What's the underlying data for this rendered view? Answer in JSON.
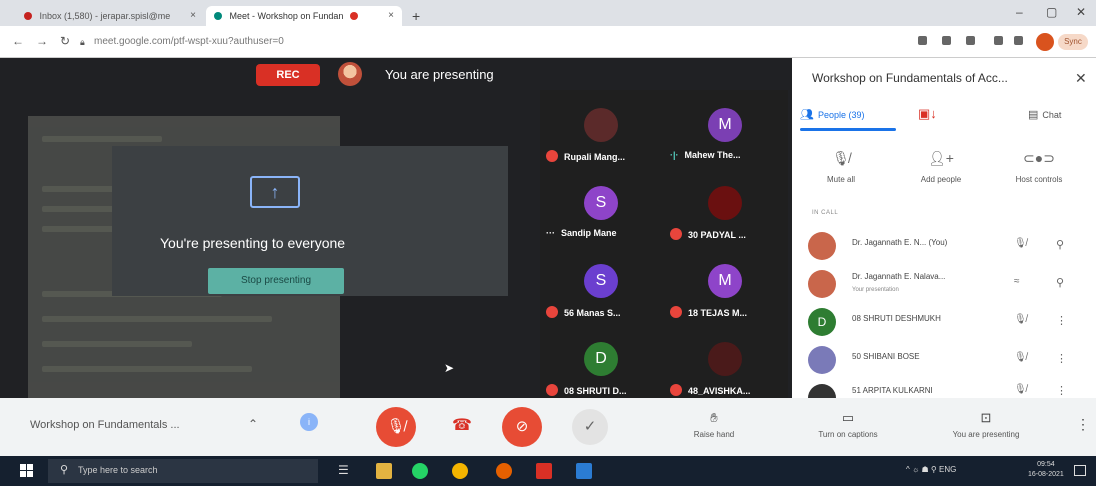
{
  "browser": {
    "tabs": [
      {
        "label": "Inbox (1,580) - jerapar.spisl@me"
      },
      {
        "label": "Meet - Workshop on Fundan"
      }
    ],
    "new_tab_symbol": "+",
    "url": "meet.google.com/ptf-wspt-xuu?authuser=0",
    "sync_label": "Sync"
  },
  "stage": {
    "rec_label": "REC",
    "presenting_label": "You are presenting",
    "presenting_to_everyone": "You're presenting to everyone",
    "stop_presenting_label": "Stop presenting"
  },
  "tiles": [
    {
      "initial": "",
      "name": "Rupali Mang...",
      "color": "#5b2a2a",
      "indicator": "mute"
    },
    {
      "initial": "M",
      "name": "Mahew The...",
      "color": "#7b3fb3",
      "indicator": "speaking"
    },
    {
      "initial": "S",
      "name": "Sandip Mane",
      "color": "#8e44c9",
      "indicator": "more"
    },
    {
      "initial": "",
      "name": "30 PADYAL ...",
      "color": "#6a1010",
      "indicator": "mute"
    },
    {
      "initial": "S",
      "name": "56 Manas S...",
      "color": "#6b3fcf",
      "indicator": "mute"
    },
    {
      "initial": "M",
      "name": "18 TEJAS M...",
      "color": "#8e44c9",
      "indicator": "mute"
    },
    {
      "initial": "D",
      "name": "08 SHRUTI D...",
      "color": "#2e7d32",
      "indicator": "mute"
    },
    {
      "initial": "",
      "name": "48_AVISHKA...",
      "color": "#4a1a1a",
      "indicator": "mute"
    }
  ],
  "panel": {
    "title": "Workshop on Fundamentals of Acc...",
    "tabs": {
      "people": "People (39)",
      "chat": "Chat"
    },
    "actions": {
      "mute_all": "Mute all",
      "add_people": "Add people",
      "host_controls": "Host controls"
    },
    "in_call_label": "IN CALL",
    "participants": [
      {
        "initial": "",
        "name": "Dr. Jagannath E. N... (You)",
        "sub": "",
        "color": "#c9664b",
        "right": "pin"
      },
      {
        "initial": "",
        "name": "Dr. Jagannath E. Nalava...",
        "sub": "Your presentation",
        "color": "#c9664b",
        "right": "pin"
      },
      {
        "initial": "D",
        "name": "08 SHRUTI DESHMUKH",
        "sub": "",
        "color": "#2e7d32",
        "right": "more"
      },
      {
        "initial": "",
        "name": "50 SHIBANI BOSE",
        "sub": "",
        "color": "#7a7ab8",
        "right": "more"
      },
      {
        "initial": "",
        "name": "51 ARPITA KULKARNI",
        "sub": "",
        "color": "#333",
        "right": "more"
      }
    ]
  },
  "controls": {
    "meeting_name": "Workshop on Fundamentals ...",
    "raise_hand": "Raise hand",
    "captions": "Turn on captions",
    "presenting": "You are presenting"
  },
  "taskbar": {
    "search_placeholder": "Type here to search",
    "tray": "^ ☼ ☗ ⚲ ENG",
    "time": "09:54",
    "date": "16-08-2021"
  },
  "icons": {
    "mic_off": "mic-off-icon",
    "hangup": "hangup-icon",
    "camera_off": "camera-off-icon",
    "hand": "raise-hand-icon",
    "captions": "captions-icon",
    "present": "present-icon"
  },
  "colors": {
    "accent_blue": "#1a73e8",
    "danger_red": "#e74c35",
    "stop_teal": "#5cb1a4"
  }
}
